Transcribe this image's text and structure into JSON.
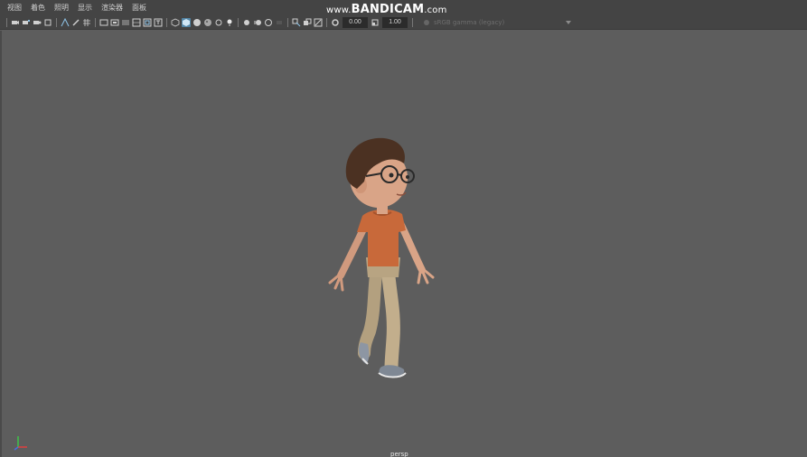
{
  "watermark": {
    "prefix": "www.",
    "brand": "BANDICAM",
    "suffix": ".com"
  },
  "menu": {
    "items": [
      {
        "label": "视图"
      },
      {
        "label": "着色"
      },
      {
        "label": "照明"
      },
      {
        "label": "显示"
      },
      {
        "label": "渲染器"
      },
      {
        "label": "面板"
      }
    ]
  },
  "toolbar": {
    "exposure_value": "0.00",
    "gamma_value": "1.00",
    "color_space": "sRGB gamma (legacy)"
  },
  "viewport": {
    "camera_label": "persp"
  },
  "colors": {
    "viewport_bg": "#5d5d5d",
    "panel_bg": "#444444",
    "active_icon": "#5285a6",
    "shirt": "#c8693a",
    "pants": "#b8a482",
    "skin": "#d9a487",
    "hair": "#4b3122"
  }
}
